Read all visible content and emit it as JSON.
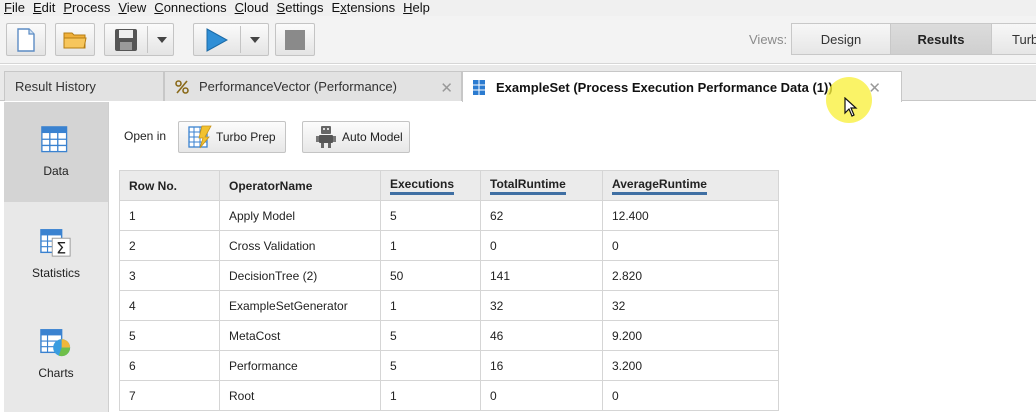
{
  "menu": [
    "File",
    "Edit",
    "Process",
    "View",
    "Connections",
    "Cloud",
    "Settings",
    "Extensions",
    "Help"
  ],
  "menu_underline": [
    "F",
    "E",
    "P",
    "V",
    "C",
    "C",
    "S",
    "x",
    "H"
  ],
  "toolbar": {
    "views_label": "Views:",
    "views": [
      "Design",
      "Results",
      "Turb"
    ],
    "active_view": "Results"
  },
  "tabs": [
    {
      "label": "Result History"
    },
    {
      "label": "PerformanceVector (Performance)"
    },
    {
      "label": "ExampleSet (Process Execution Performance Data (1))"
    }
  ],
  "side": [
    {
      "label": "Data",
      "icon": "table-icon"
    },
    {
      "label": "Statistics",
      "icon": "statistics-icon"
    },
    {
      "label": "Charts",
      "icon": "charts-icon"
    }
  ],
  "open_in": {
    "label": "Open in",
    "turbo_prep": "Turbo Prep",
    "auto_model": "Auto Model"
  },
  "table": {
    "headers": [
      "Row No.",
      "OperatorName",
      "Executions",
      "TotalRuntime",
      "AverageRuntime"
    ],
    "rows": [
      [
        "1",
        "Apply Model",
        "5",
        "62",
        "12.400"
      ],
      [
        "2",
        "Cross Validation",
        "1",
        "0",
        "0"
      ],
      [
        "3",
        "DecisionTree (2)",
        "50",
        "141",
        "2.820"
      ],
      [
        "4",
        "ExampleSetGenerator",
        "1",
        "32",
        "32"
      ],
      [
        "5",
        "MetaCost",
        "5",
        "46",
        "9.200"
      ],
      [
        "6",
        "Performance",
        "5",
        "16",
        "3.200"
      ],
      [
        "7",
        "Root",
        "1",
        "0",
        "0"
      ]
    ]
  },
  "colors": {
    "accent_blue": "#3f6fa3",
    "cursor_highlight": "#f8f03c"
  }
}
